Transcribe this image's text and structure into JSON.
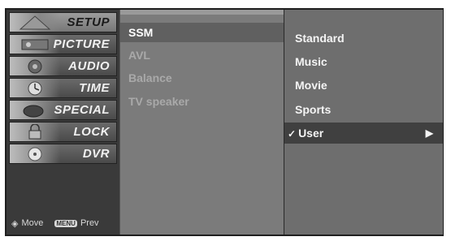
{
  "sidebar": {
    "items": [
      {
        "label": "SETUP",
        "icon": "setup-icon"
      },
      {
        "label": "PICTURE",
        "icon": "picture-icon"
      },
      {
        "label": "AUDIO",
        "icon": "audio-icon"
      },
      {
        "label": "TIME",
        "icon": "clock-icon"
      },
      {
        "label": "SPECIAL",
        "icon": "special-icon"
      },
      {
        "label": "LOCK",
        "icon": "lock-icon"
      },
      {
        "label": "DVR",
        "icon": "dvr-icon"
      }
    ],
    "hint_move": "Move",
    "hint_menu_key": "MENU",
    "hint_prev": "Prev"
  },
  "submenu": {
    "items": [
      "SSM",
      "AVL",
      "Balance",
      "TV speaker"
    ]
  },
  "options": {
    "items": [
      "Standard",
      "Music",
      "Movie",
      "Sports",
      "User"
    ],
    "selected_check": "✓",
    "selected_arrow": "▶"
  }
}
